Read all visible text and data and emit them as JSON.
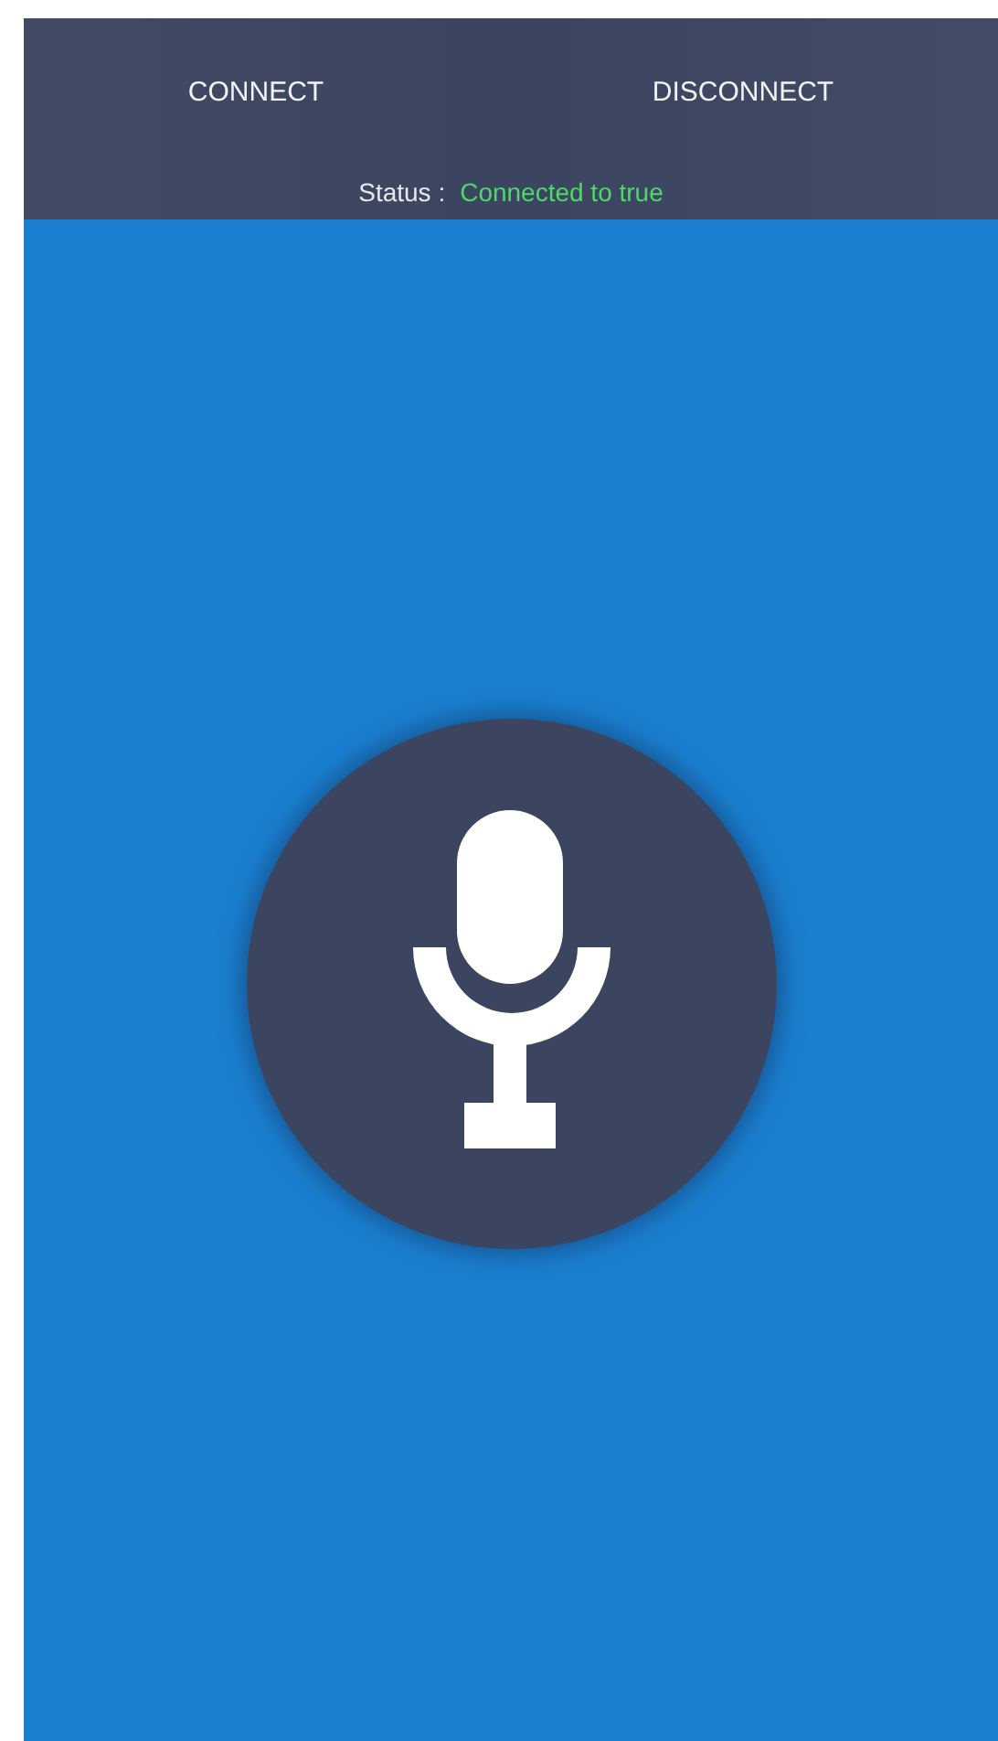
{
  "buttons": [
    {
      "label": "CONNECT"
    },
    {
      "label": "DISCONNECT"
    }
  ],
  "status": {
    "label": "Status :",
    "value": "Connected to true"
  }
}
